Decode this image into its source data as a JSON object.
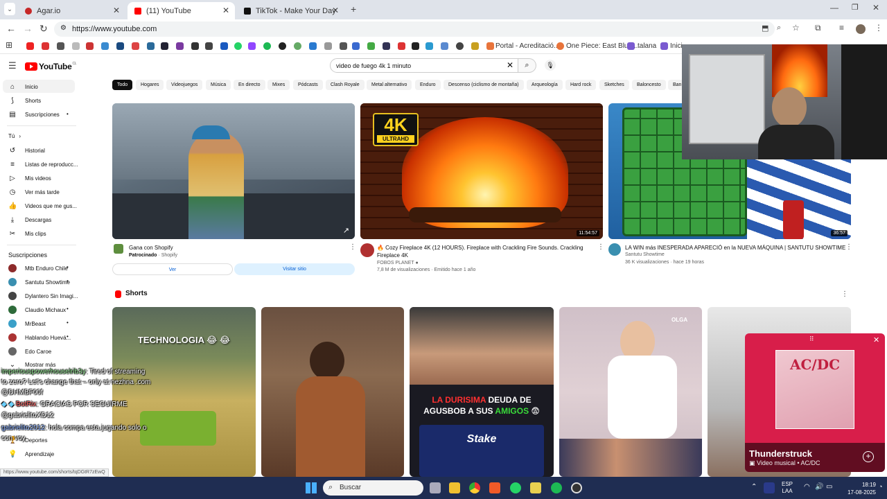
{
  "browser": {
    "tabs": [
      {
        "title": "Agar.io",
        "color": "#c62828"
      },
      {
        "title": "(11) YouTube",
        "color": "#ff0000"
      },
      {
        "title": "TikTok - Make Your Day",
        "color": "#111111"
      }
    ],
    "url": "https://www.youtube.com",
    "bookmarks": [
      {
        "label": "Portal - Acreditació..."
      },
      {
        "label": "One Piece: East Blue..."
      },
      {
        "label": "talana"
      },
      {
        "label": "Inici"
      }
    ]
  },
  "youtube": {
    "logo": "YouTube",
    "logo_region": "CL",
    "search_value": "video de fuego 4k 1 minuto",
    "sidebar_main": [
      {
        "label": "Inicio",
        "icon": "home-icon"
      },
      {
        "label": "Shorts",
        "icon": "shorts-icon"
      },
      {
        "label": "Suscripciones",
        "icon": "subscriptions-icon"
      }
    ],
    "you_label": "Tú",
    "you_items": [
      {
        "label": "Historial",
        "icon": "history-icon"
      },
      {
        "label": "Listas de reproducc...",
        "icon": "playlist-icon"
      },
      {
        "label": "Mis videos",
        "icon": "video-icon"
      },
      {
        "label": "Ver más tarde",
        "icon": "clock-icon"
      },
      {
        "label": "Videos que me gus...",
        "icon": "like-icon"
      },
      {
        "label": "Descargas",
        "icon": "download-icon"
      },
      {
        "label": "Mis clips",
        "icon": "scissors-icon"
      }
    ],
    "subs_header": "Suscripciones",
    "subscriptions": [
      {
        "label": "Mtb Enduro Chile",
        "color": "#8d2b2b"
      },
      {
        "label": "Santutu Showtime",
        "color": "#3a8fb0"
      },
      {
        "label": "Dylantero Sin Imagi...",
        "color": "#444444"
      },
      {
        "label": "Claudio Michaux",
        "color": "#2e6b3a"
      },
      {
        "label": "MrBeast",
        "color": "#3aa0c8"
      },
      {
        "label": "Hablando Huevá...",
        "color": "#a33"
      },
      {
        "label": "Edo Caroe",
        "color": "#666"
      }
    ],
    "show_more": "Mostrar más",
    "bottom_items": [
      {
        "label": "Deportes"
      },
      {
        "label": "Aprendizaje"
      }
    ],
    "chips": [
      "Todo",
      "Hogares",
      "Videojuegos",
      "Música",
      "En directo",
      "Mixes",
      "Pódcasts",
      "Clash Royale",
      "Metal alternativo",
      "Enduro",
      "Descenso (ciclismo de montaña)",
      "Arqueología",
      "Hard rock",
      "Sketches",
      "Baloncesto",
      "Ban"
    ],
    "videos": [
      {
        "title": "Gana con Shopify",
        "sponsored": "Patrocinado",
        "channel": "Shopify",
        "btn1": "Ver",
        "btn2": "Visitar sitio"
      },
      {
        "title": "🔥 Cozy Fireplace 4K (12 HOURS). Fireplace with Crackling Fire Sounds. Crackling Fireplace 4K",
        "channel": "FOBOS PLANET",
        "meta": "7,8 M de visualizaciones · Emitido hace 1 año",
        "duration": "11:54:57",
        "badge_big": "4K",
        "badge_small": "ULTRAHD"
      },
      {
        "title": "LA WIN más INESPERADA APARECIÓ en la NUEVA MÁQUINA | SANTUTU SHOWTIME",
        "channel": "Santutu Showtime",
        "meta": "36 K visualizaciones · hace 19 horas",
        "duration": "36:57"
      }
    ],
    "shorts_label": "Shorts",
    "shorts": [
      {
        "caption": "TECHNOLOGIA 😂 😂"
      },
      {
        "caption": ""
      },
      {
        "caption_red": "LA DURISIMA",
        "caption_white": "DEUDA DE",
        "caption2_white": "AGUSBOB A SUS",
        "caption2_green": "AMIGOS",
        "emoji": "😨",
        "sponsor": "Stake"
      },
      {
        "caption": "OLGA"
      },
      {
        "caption": ""
      }
    ],
    "miniplayer": {
      "title": "Thunderstruck",
      "subtitle": "Video musical • AC/DC",
      "album_text": "AC/DC"
    }
  },
  "chat": [
    {
      "user": "imperiouspowerhouselrib3y",
      "text": ": Tired of streaming",
      "cont": "to zero? Let's change that – only at nezhna .com"
    },
    {
      "user": "@DHMBF00f",
      "text": ""
    },
    {
      "user": "BotRix",
      "text": ": GRACIAS POR SEGUIRME"
    },
    {
      "user": "@gabrielitoXD12",
      "text": ""
    },
    {
      "user": "gabrielito2012",
      "text": ": hola compa esta jugando solo o",
      "cont": "con voy"
    }
  ],
  "statusbar_url": "https://www.youtube.com/shorts/tqDGtR7zEwQ",
  "taskbar": {
    "search": "Buscar",
    "lang1": "ESP",
    "lang2": "LAA",
    "time": "18:19",
    "date": "17-08-2025"
  }
}
